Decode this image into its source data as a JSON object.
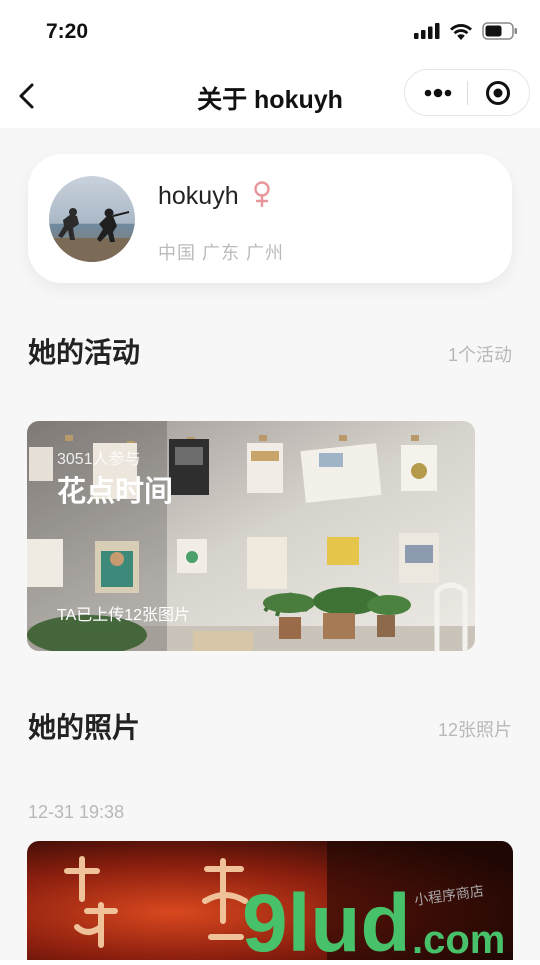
{
  "status_bar": {
    "time": "7:20"
  },
  "nav": {
    "title": "关于 hokuyh"
  },
  "profile": {
    "username": "hokuyh",
    "location": "中国 广东 广州"
  },
  "activities": {
    "heading": "她的活动",
    "count": "1个活动"
  },
  "activity_card": {
    "participants": "3051人参与",
    "title": "花点时间",
    "uploads": "TA已上传12张图片"
  },
  "photos": {
    "heading": "她的照片",
    "count": "12张照片",
    "datetime": "12-31 19:38"
  },
  "watermark": {
    "brand": "9lud",
    "domain": ".com",
    "tagline": "小程序商店"
  },
  "colors": {
    "gender_female": "#e8959b",
    "watermark_green": "#48c26a"
  }
}
